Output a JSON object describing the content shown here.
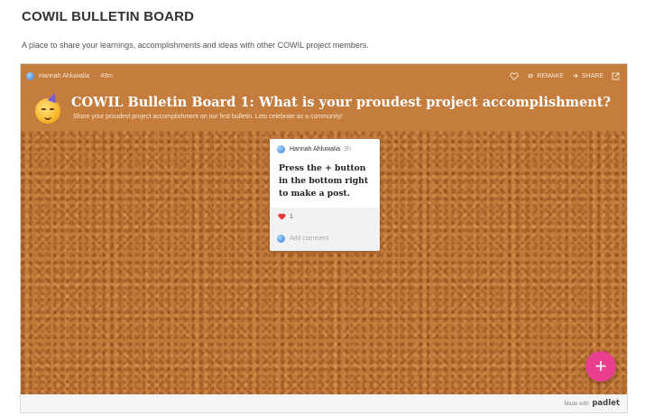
{
  "page": {
    "title": "COWIL BULLETIN BOARD",
    "description": "A place to share your learnings, accomplishments and ideas with other COWIL project members."
  },
  "padlet": {
    "topbar": {
      "author": "Hannah Ahluwalia",
      "time": "49m",
      "remake_label": "REMAKE",
      "share_label": "SHARE",
      "icons": [
        "globe-icon",
        "heart-outline-icon",
        "remake-icon",
        "share-icon",
        "external-link-icon"
      ]
    },
    "header": {
      "title": "COWIL Bulletin Board 1: What is your proudest project accomplishment?",
      "subtitle": "Share your proudest project accomplishment on our first bulletin. Lets celebrate as a community!",
      "emoji": "partying-face-emoji"
    },
    "post": {
      "author": "Hannah Ahluwalia",
      "time": "3h",
      "body": "Press the + button in the bottom right to make a post.",
      "likes": "1",
      "comment_placeholder": "Add comment"
    },
    "fab_label": "+",
    "made_with_prefix": "Made with",
    "made_with_brand": "padlet"
  },
  "colors": {
    "header_bg": "#c47d3d",
    "cork": "#c27a3a",
    "fab": "#ea3f8f",
    "like_heart": "#e53935"
  }
}
